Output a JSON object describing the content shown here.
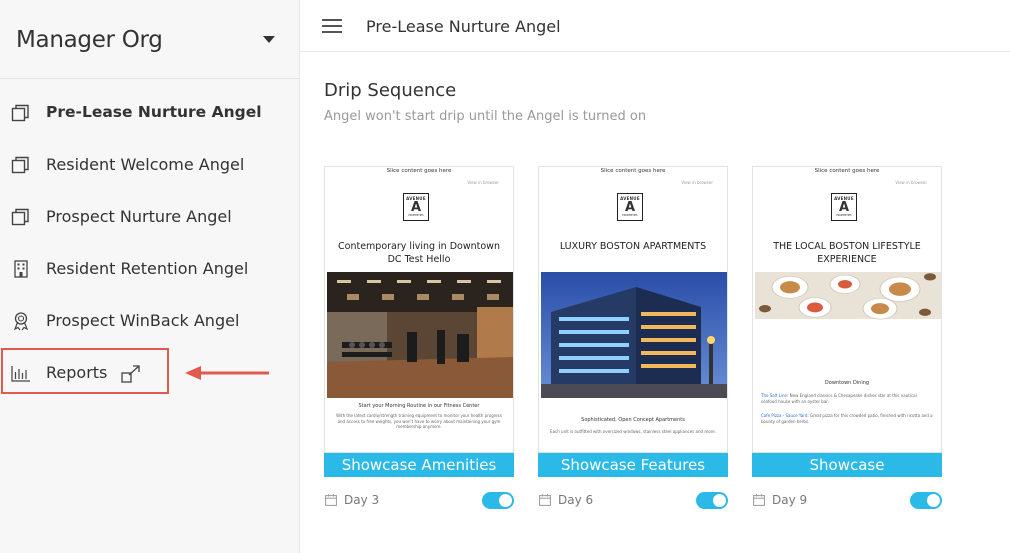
{
  "sidebar": {
    "org_name": "Manager Org",
    "items": [
      {
        "label": "Pre-Lease Nurture Angel",
        "icon": "copy-icon",
        "active": true
      },
      {
        "label": "Resident Welcome Angel",
        "icon": "copy-icon"
      },
      {
        "label": "Prospect Nurture Angel",
        "icon": "copy-icon"
      },
      {
        "label": "Resident Retention Angel",
        "icon": "building-icon"
      },
      {
        "label": "Prospect WinBack Angel",
        "icon": "award-icon"
      },
      {
        "label": "Reports",
        "icon": "bar-chart-icon"
      }
    ]
  },
  "topbar": {
    "title": "Pre-Lease Nurture Angel"
  },
  "main": {
    "title": "Drip Sequence",
    "subtitle": "Angel won't start drip until the Angel is turned on"
  },
  "colors": {
    "accent": "#2bb9e8",
    "highlight": "#e05a4f"
  },
  "cards": [
    {
      "preview_top": "Slice content goes here",
      "preview_view": "View in browser",
      "logo_name": "AVENUE",
      "logo_letter": "A",
      "logo_sub": "PROPERTIES",
      "headline": "Contemporary living in Downtown DC Test Hello",
      "caption": "Start your Morning Routine in our Fitness Center",
      "body": "With the latest cardio/strength training equipment to monitor your health progress and access to free weights, you won't have to worry about maintaining your gym membership anymore.",
      "cta": "Showcase Amenities",
      "day": "Day 3",
      "enabled": true
    },
    {
      "preview_top": "Slice content goes here",
      "preview_view": "View in browser",
      "logo_name": "AVENUE",
      "logo_letter": "A",
      "logo_sub": "PROPERTIES",
      "headline": "LUXURY BOSTON APARTMENTS",
      "caption": "Sophisticated, Open Concept Apartments",
      "body": "Each unit is outfitted with oversized windows, stainless steel appliances and more.",
      "cta": "Showcase Features",
      "day": "Day 6",
      "enabled": true
    },
    {
      "preview_top": "Slice content goes here",
      "preview_view": "View in browser",
      "logo_name": "AVENUE",
      "logo_letter": "A",
      "logo_sub": "PROPERTIES",
      "headline": "THE LOCAL BOSTON LIFESTYLE EXPERIENCE",
      "caption": "Downtown Dining",
      "body_1_highlight": "The Salt Line",
      "body_1": ": New England classics & Chesapeake dishes star at this nautical seafood house with an oyster bar.",
      "body_2_highlight": "Cafe Pizza - Sauce Yard",
      "body_2": ": Great pizza for this crowded patio, finished with ricotta and a bounty of garden herbs.",
      "cta": "Showcase",
      "day": "Day 9",
      "enabled": true
    }
  ]
}
